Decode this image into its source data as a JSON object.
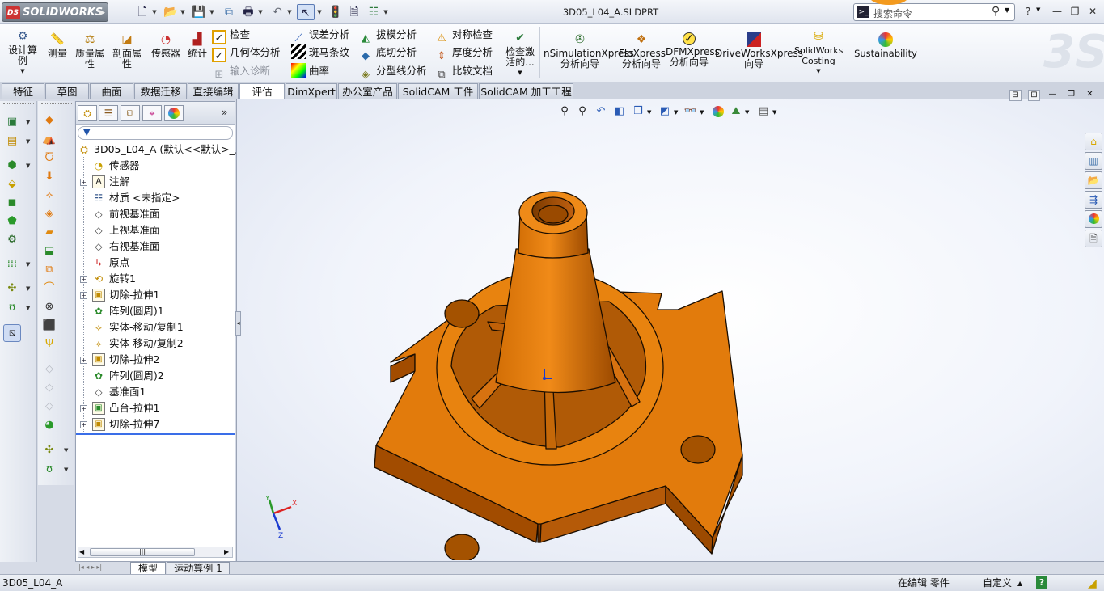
{
  "title_bar": {
    "app_name": "SOLIDWORKS",
    "document_title": "3D05_L04_A.SLDPRT",
    "search_placeholder": "搜索命令",
    "help_label": "?"
  },
  "ribbon": {
    "large_buttons_left": [
      {
        "label": "设计算例",
        "icon": "design-study-icon"
      },
      {
        "label": "测量",
        "icon": "measure-icon"
      },
      {
        "label": "质量属性",
        "icon": "mass-properties-icon"
      },
      {
        "label": "剖面属性",
        "icon": "section-properties-icon"
      },
      {
        "label": "传感器",
        "icon": "sensor-icon"
      },
      {
        "label": "统计",
        "icon": "statistics-icon"
      }
    ],
    "col1": [
      "检查",
      "几何体分析",
      "输入诊断"
    ],
    "col2": [
      "误差分析",
      "斑马条纹",
      "曲率"
    ],
    "col3": [
      "拔模分析",
      "底切分析",
      "分型线分析"
    ],
    "col4": [
      "对称检查",
      "厚度分析",
      "比较文档"
    ],
    "check_active": "检查激活的...",
    "large_buttons_right": [
      {
        "label": "nSimulationXpress 分析向导",
        "icon": "simulationxpress-icon"
      },
      {
        "label": "FloXpress 分析向导",
        "icon": "floxpress-icon"
      },
      {
        "label": "DFMXpress 分析向导",
        "icon": "dfmxpress-icon"
      },
      {
        "label": "DriveWorksXpress 向导",
        "icon": "driveworksxpress-icon"
      },
      {
        "label": "SolidWorks Costing",
        "icon": "costing-icon"
      },
      {
        "label": "Sustainability",
        "icon": "sustainability-icon"
      }
    ]
  },
  "tabs": [
    "特征",
    "草图",
    "曲面",
    "数据迁移",
    "直接编辑",
    "评估",
    "DimXpert",
    "办公室产品",
    "SolidCAM 工件",
    "SolidCAM 加工工程"
  ],
  "active_tab": "评估",
  "feature_tree": {
    "root": "3D05_L04_A  (默认<<默认>_显",
    "items": [
      {
        "label": "传感器",
        "icon": "sensor-icon",
        "expandable": false
      },
      {
        "label": "注解",
        "icon": "annotations-icon",
        "expandable": true
      },
      {
        "label": "材质 <未指定>",
        "icon": "material-icon",
        "expandable": false
      },
      {
        "label": "前视基准面",
        "icon": "plane-icon",
        "expandable": false
      },
      {
        "label": "上视基准面",
        "icon": "plane-icon",
        "expandable": false
      },
      {
        "label": "右视基准面",
        "icon": "plane-icon",
        "expandable": false
      },
      {
        "label": "原点",
        "icon": "origin-icon",
        "expandable": false
      },
      {
        "label": "旋转1",
        "icon": "revolve-icon",
        "expandable": true
      },
      {
        "label": "切除-拉伸1",
        "icon": "extrude-cut-icon",
        "expandable": true
      },
      {
        "label": "阵列(圆周)1",
        "icon": "circular-pattern-icon",
        "expandable": false
      },
      {
        "label": "实体-移动/复制1",
        "icon": "move-copy-icon",
        "expandable": false
      },
      {
        "label": "实体-移动/复制2",
        "icon": "move-copy-icon",
        "expandable": false
      },
      {
        "label": "切除-拉伸2",
        "icon": "extrude-cut-icon",
        "expandable": true
      },
      {
        "label": "阵列(圆周)2",
        "icon": "circular-pattern-icon",
        "expandable": false
      },
      {
        "label": "基准面1",
        "icon": "plane-icon",
        "expandable": false
      },
      {
        "label": "凸台-拉伸1",
        "icon": "boss-extrude-icon",
        "expandable": true
      },
      {
        "label": "切除-拉伸7",
        "icon": "extrude-cut-icon",
        "expandable": true
      }
    ],
    "scroll_thumb": "|||"
  },
  "bottom_tabs": [
    "模型",
    "运动算例 1"
  ],
  "triad": {
    "x": "X",
    "y": "Y",
    "z": "Z"
  },
  "status_bar": {
    "left": "3D05_L04_A",
    "editing": "在编辑 零件",
    "units": "自定义",
    "help": "?"
  },
  "colors": {
    "part_face": "#e27b0c",
    "part_dark": "#a24c00",
    "part_edge": "#1a0d00",
    "accent_blue": "#3a6ee8"
  }
}
